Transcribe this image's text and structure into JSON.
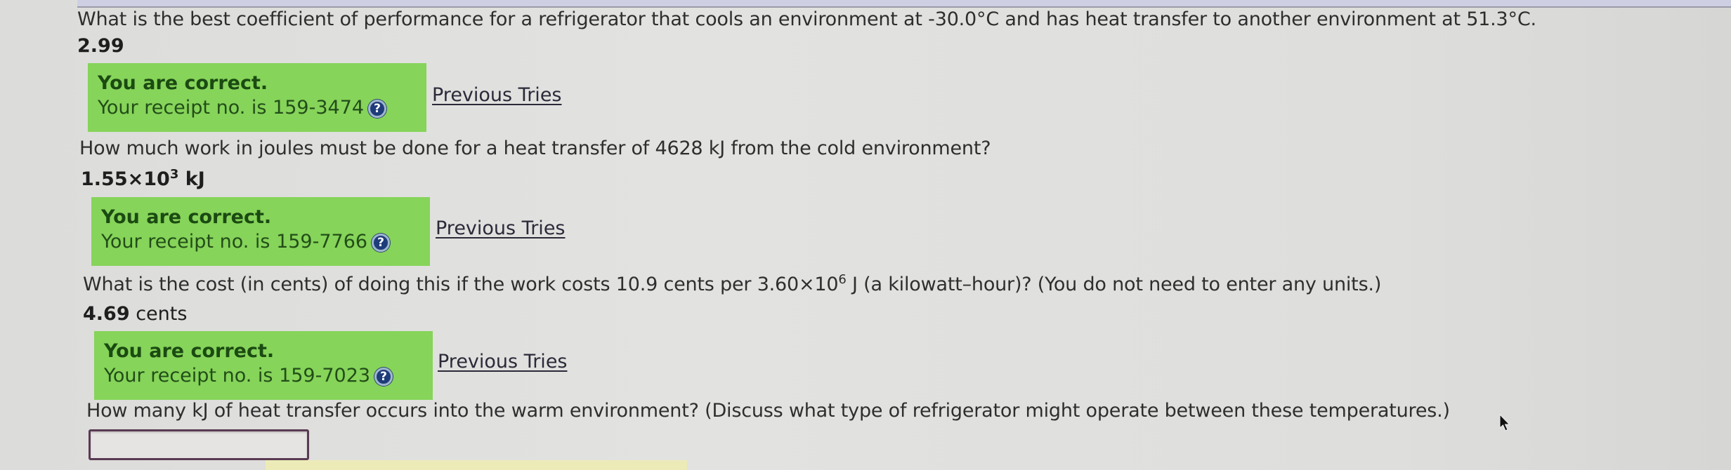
{
  "questions": [
    {
      "prompt": "What is the best coefficient of performance for a refrigerator that cools an environment at -30.0°C and has heat transfer to another environment at 51.3°C.",
      "answer_bold": "2.99",
      "answer_tail": "",
      "feedback_title": "You are correct.",
      "receipt": "Your receipt no. is 159-3474",
      "previous_tries": "Previous Tries"
    },
    {
      "prompt": "How much work in joules must be done for a heat transfer of 4628 kJ from the cold environment?",
      "answer_mantissa": "1.55×10",
      "answer_exponent": "3",
      "answer_unit": " kJ",
      "feedback_title": "You are correct.",
      "receipt": "Your receipt no. is 159-7766",
      "previous_tries": "Previous Tries"
    },
    {
      "prompt_before": "What is the cost (in cents) of doing this if the work costs 10.9 cents per 3.60×10",
      "prompt_exponent": "6",
      "prompt_after": " J (a kilowatt–hour)? (You do not need to enter any units.)",
      "answer_bold": "4.69",
      "answer_tail": " cents",
      "feedback_title": "You are correct.",
      "receipt": "Your receipt no. is 159-7023",
      "previous_tries": "Previous Tries"
    },
    {
      "prompt": "How many kJ of heat transfer occurs into the warm environment? (Discuss what type of refrigerator might operate between these temperatures.)",
      "input_value": ""
    }
  ],
  "icons": {
    "help": "help-circle-icon",
    "cursor": "mouse-pointer-icon"
  },
  "colors": {
    "correct_bg": "#86d45a",
    "correct_text": "#1b4a12",
    "input_border": "#5a3a52"
  }
}
